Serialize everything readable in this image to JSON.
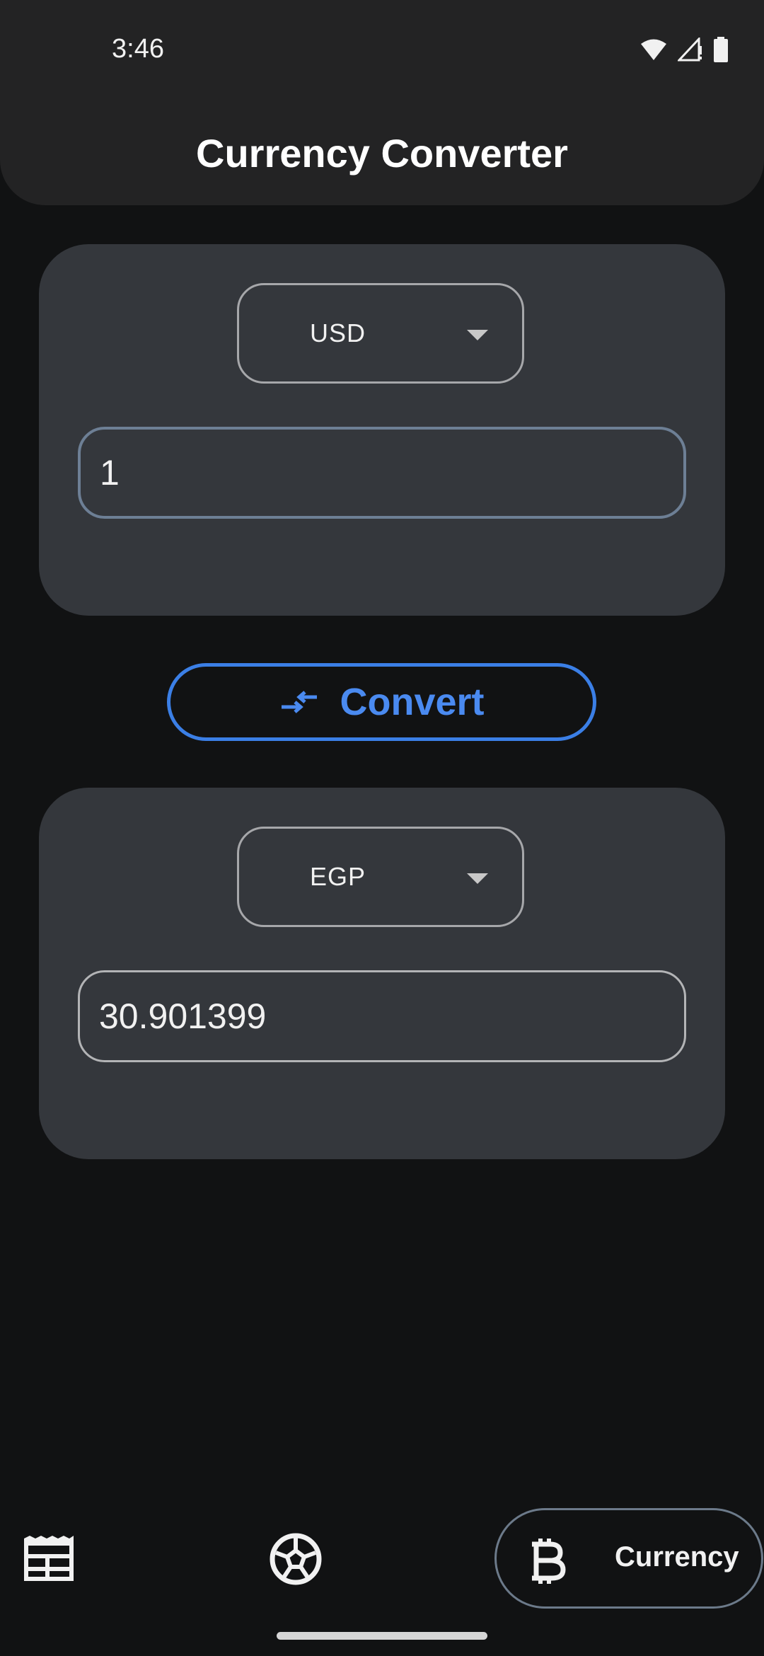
{
  "status_bar": {
    "time": "3:46"
  },
  "header": {
    "title": "Currency Converter"
  },
  "from_card": {
    "currency": "USD",
    "amount": "1"
  },
  "convert_button": {
    "label": "Convert"
  },
  "to_card": {
    "currency": "EGP",
    "amount": "30.901399"
  },
  "bottom_nav": {
    "items": [
      {
        "icon": "news-icon",
        "label": ""
      },
      {
        "icon": "soccer-ball-icon",
        "label": ""
      },
      {
        "icon": "bitcoin-icon",
        "label": "Currency",
        "selected": true
      }
    ]
  },
  "colors": {
    "background": "#111213",
    "header": "#232324",
    "card": "#34373c",
    "accent": "#3b7fe6"
  }
}
